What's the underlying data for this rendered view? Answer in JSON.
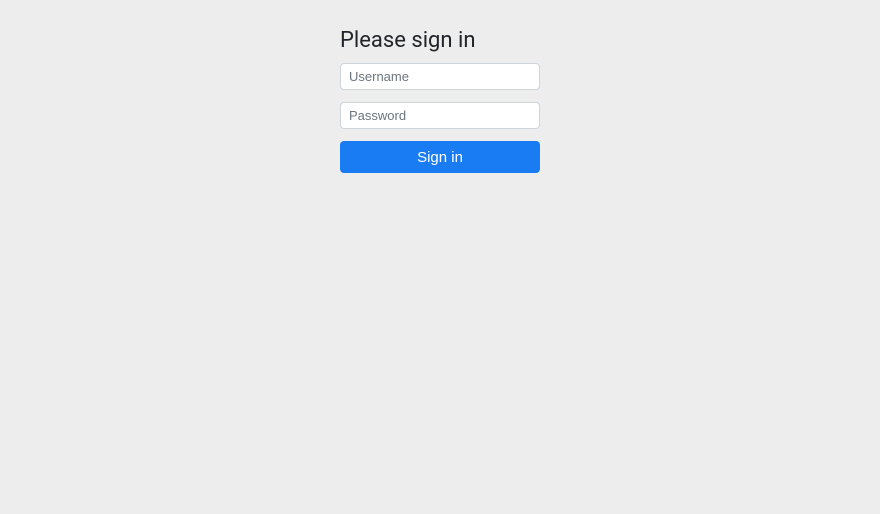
{
  "login": {
    "heading": "Please sign in",
    "username_placeholder": "Username",
    "password_placeholder": "Password",
    "submit_label": "Sign in"
  }
}
